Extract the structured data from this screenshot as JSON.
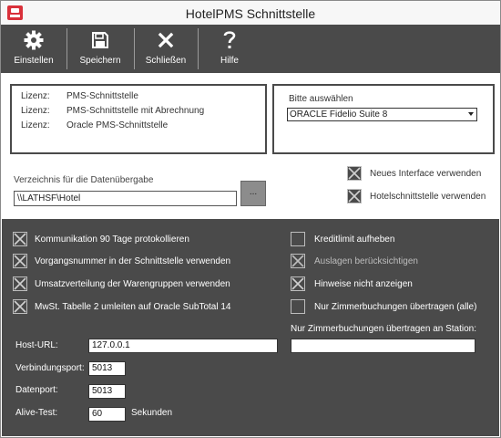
{
  "window": {
    "title": "HotelPMS Schnittstelle"
  },
  "toolbar": {
    "buttons": [
      {
        "label": "Einstellen",
        "icon": "gear-icon"
      },
      {
        "label": "Speichern",
        "icon": "save-icon"
      },
      {
        "label": "Schließen",
        "icon": "close-icon"
      },
      {
        "label": "Hilfe",
        "icon": "help-icon"
      }
    ]
  },
  "license": {
    "rows": [
      {
        "key": "Lizenz:",
        "value": "PMS-Schnittstelle"
      },
      {
        "key": "Lizenz:",
        "value": "PMS-Schnittstelle mit Abrechnung"
      },
      {
        "key": "Lizenz:",
        "value": "Oracle PMS-Schnittstelle"
      }
    ]
  },
  "selection": {
    "label": "Bitte auswählen",
    "value": "ORACLE Fidelio Suite 8"
  },
  "directory": {
    "label": "Verzeichnis für die Datenübergabe",
    "value": "\\\\LATHSF\\Hotel",
    "browse_label": "..."
  },
  "top_options": [
    {
      "label": "Neues Interface verwenden",
      "checked": true
    },
    {
      "label": "Hotelschnittstelle verwenden",
      "checked": true
    }
  ],
  "options_left": [
    {
      "label": "Kommunikation 90 Tage protokollieren",
      "checked": true
    },
    {
      "label": "Vorgangsnummer in der Schnittstelle verwenden",
      "checked": true
    },
    {
      "label": "Umsatzverteilung der Warengruppen verwenden",
      "checked": true
    },
    {
      "label": "MwSt. Tabelle 2 umleiten auf Oracle SubTotal 14",
      "checked": true
    }
  ],
  "options_right": [
    {
      "label": "Kreditlimit aufheben",
      "checked": false
    },
    {
      "label": "Auslagen berücksichtigen",
      "checked": true
    },
    {
      "label": "Hinweise nicht anzeigen",
      "checked": true
    },
    {
      "label": "Nur Zimmerbuchungen übertragen (alle)",
      "checked": false
    }
  ],
  "station": {
    "label": "Nur Zimmerbuchungen übertragen an Station:",
    "value": ""
  },
  "connection": {
    "host_label": "Host-URL:",
    "host_value": "127.0.0.1",
    "port_label": "Verbindungsport:",
    "port_value": "5013",
    "dataport_label": "Datenport:",
    "dataport_value": "5013",
    "alive_label": "Alive-Test:",
    "alive_value": "60",
    "alive_unit": "Sekunden"
  }
}
